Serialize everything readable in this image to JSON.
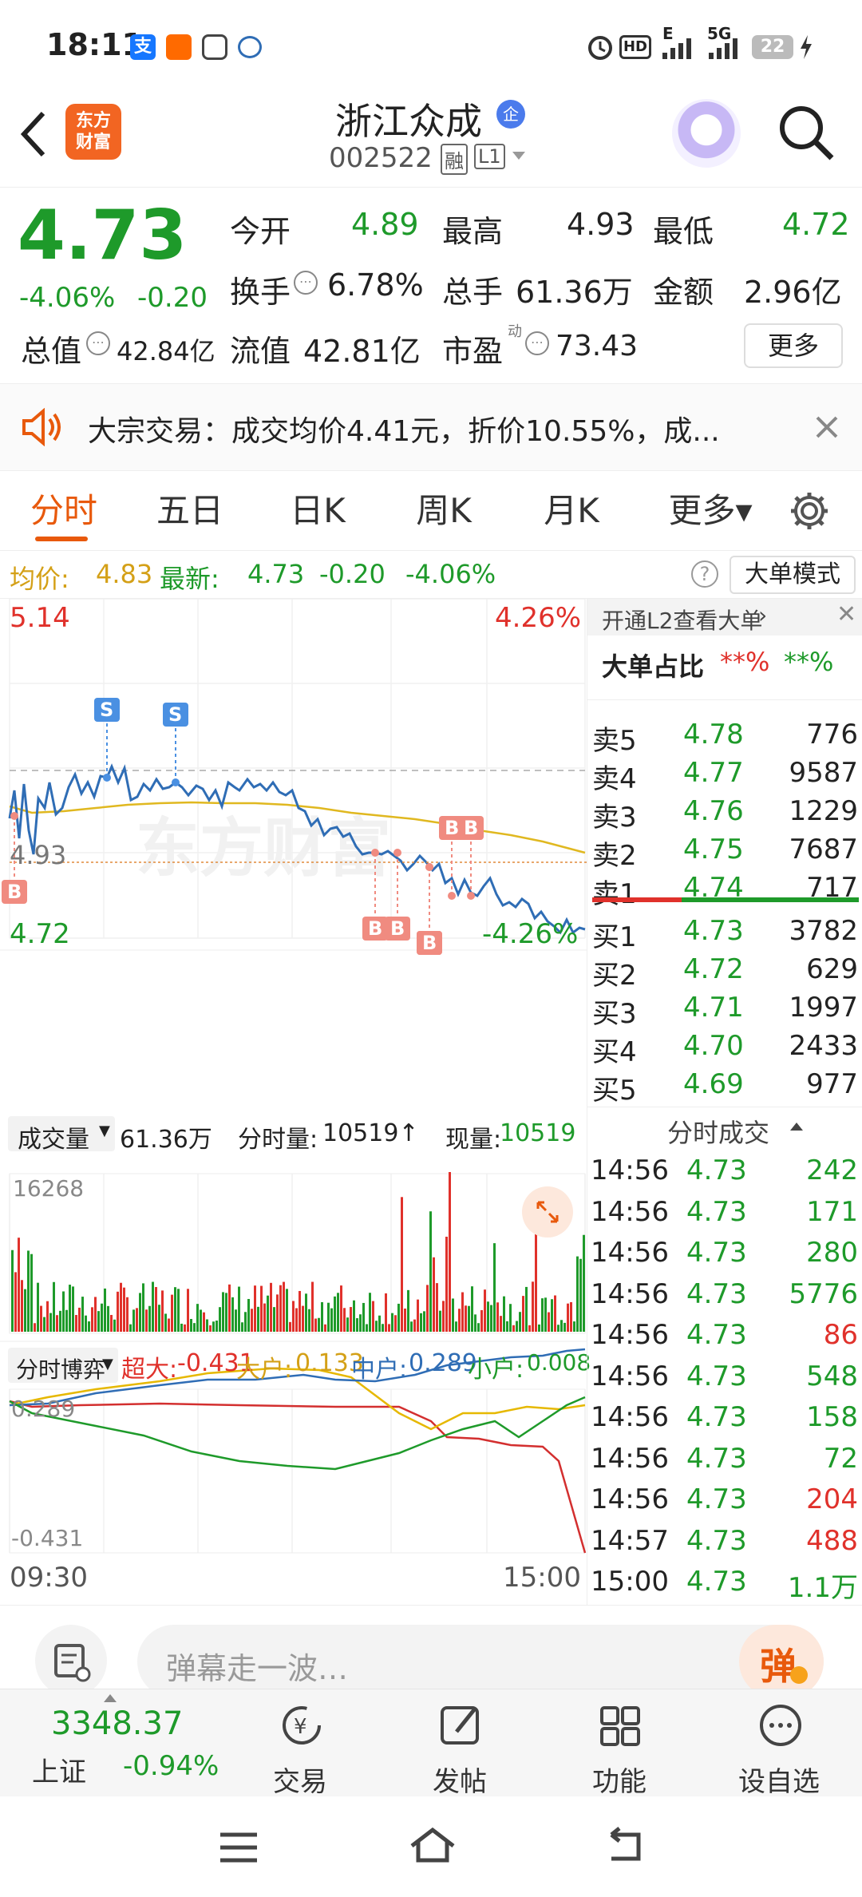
{
  "status_bar": {
    "time": "18:11",
    "app_icons": [
      "alipay-icon",
      "taobao-icon",
      "bot-icon",
      "wallet-icon"
    ],
    "right_icons": [
      "alarm-icon",
      "hd-icon",
      "signal-e-icon",
      "signal-5g-icon"
    ],
    "hd_label": "HD",
    "net1": "E",
    "net2": "5G",
    "battery": "22"
  },
  "header": {
    "stock_name": "浙江众成",
    "enterprise_badge": "企",
    "stock_code": "002522",
    "margin_badge": "融",
    "level_badge": "L1",
    "logo_line1": "东方",
    "logo_line2": "财富"
  },
  "quote": {
    "price": "4.73",
    "change_pct": "-4.06%",
    "change": "-0.20",
    "open_label": "今开",
    "open": "4.89",
    "high_label": "最高",
    "high": "4.93",
    "low_label": "最低",
    "low": "4.72",
    "turnover_label": "换手",
    "turnover": "6.78%",
    "volume_label": "总手",
    "volume": "61.36万",
    "amount_label": "金额",
    "amount": "2.96亿",
    "mktcap_label": "总值",
    "mktcap": "42.84亿",
    "float_label": "流值",
    "float_cap": "42.81亿",
    "pe_label": "市盈",
    "pe_sup": "动",
    "pe": "73.43",
    "more_button": "更多"
  },
  "notice": {
    "text": "大宗交易：成交均价4.41元，折价10.55%，成..."
  },
  "tabs": {
    "items": [
      "分时",
      "五日",
      "日K",
      "周K",
      "月K",
      "更多▾"
    ],
    "active": "分时"
  },
  "info_line": {
    "avg_label": "均价:",
    "avg": "4.83",
    "latest_label": "最新:",
    "latest": "4.73",
    "change": "-0.20",
    "change_pct": "-4.06%",
    "help": "?",
    "bigorder_button": "大单模式"
  },
  "chart": {
    "top_price": "5.14",
    "top_pct": "4.26%",
    "bottom_price": "4.72",
    "bottom_pct": "-4.26%",
    "ref_price": "4.93",
    "watermark": "东方财富",
    "markers": [
      "S",
      "S",
      "B",
      "B",
      "B",
      "B",
      "B",
      "B",
      "B"
    ],
    "volume_panel": {
      "selector": "成交量",
      "total": "61.36万",
      "period_label": "分时量:",
      "period_value": "10519↑",
      "now_label": "现量:",
      "now_value": "10519",
      "max": "16268"
    },
    "flow_panel": {
      "selector": "分时博弈",
      "super_label": "超大:",
      "super": "-0.431",
      "big_label": "大户:",
      "big": "0.133",
      "mid_label": "中户:",
      "mid": "0.289",
      "small_label": "小户:",
      "small": "0.008",
      "max": "0.289",
      "min": "-0.431"
    },
    "time_start": "09:30",
    "time_end": "15:00",
    "colors": {
      "price": "#2f6db5",
      "avg": "#e0b820",
      "super": "#d32f2f",
      "big": "#e6b800",
      "mid": "#2f6db5",
      "small": "#1e9a2a"
    }
  },
  "orderbook": {
    "l2_link": "开通L2查看大单",
    "big_ratio_label": "大单占比",
    "big_ratio_red": "**%",
    "big_ratio_green": "**%",
    "asks": [
      {
        "label": "卖5",
        "price": "4.78",
        "vol": "776"
      },
      {
        "label": "卖4",
        "price": "4.77",
        "vol": "9587"
      },
      {
        "label": "卖3",
        "price": "4.76",
        "vol": "1229"
      },
      {
        "label": "卖2",
        "price": "4.75",
        "vol": "7687"
      },
      {
        "label": "卖1",
        "price": "4.74",
        "vol": "717"
      }
    ],
    "bids": [
      {
        "label": "买1",
        "price": "4.73",
        "vol": "3782"
      },
      {
        "label": "买2",
        "price": "4.72",
        "vol": "629"
      },
      {
        "label": "买3",
        "price": "4.71",
        "vol": "1997"
      },
      {
        "label": "买4",
        "price": "4.70",
        "vol": "2433"
      },
      {
        "label": "买5",
        "price": "4.69",
        "vol": "977"
      }
    ],
    "trades_title": "分时成交",
    "trades": [
      {
        "time": "14:56",
        "price": "4.73",
        "vol": "242",
        "side": "buy"
      },
      {
        "time": "14:56",
        "price": "4.73",
        "vol": "171",
        "side": "buy"
      },
      {
        "time": "14:56",
        "price": "4.73",
        "vol": "280",
        "side": "buy"
      },
      {
        "time": "14:56",
        "price": "4.73",
        "vol": "5776",
        "side": "buy"
      },
      {
        "time": "14:56",
        "price": "4.73",
        "vol": "86",
        "side": "sell"
      },
      {
        "time": "14:56",
        "price": "4.73",
        "vol": "548",
        "side": "buy"
      },
      {
        "time": "14:56",
        "price": "4.73",
        "vol": "158",
        "side": "buy"
      },
      {
        "time": "14:56",
        "price": "4.73",
        "vol": "72",
        "side": "buy"
      },
      {
        "time": "14:56",
        "price": "4.73",
        "vol": "204",
        "side": "sell"
      },
      {
        "time": "14:57",
        "price": "4.73",
        "vol": "488",
        "side": "sell"
      },
      {
        "time": "15:00",
        "price": "4.73",
        "vol": "1.1万",
        "side": "buy"
      }
    ]
  },
  "comment_bar": {
    "placeholder": "弹幕走一波…",
    "danmu_button": "弹"
  },
  "bottom_nav": {
    "index_value": "3348.37",
    "index_name": "上证",
    "index_change": "-0.94%",
    "items": [
      {
        "label": "交易",
        "icon": "trade-icon"
      },
      {
        "label": "发帖",
        "icon": "post-icon"
      },
      {
        "label": "功能",
        "icon": "grid-icon"
      },
      {
        "label": "设自选",
        "icon": "more-icon"
      }
    ]
  }
}
